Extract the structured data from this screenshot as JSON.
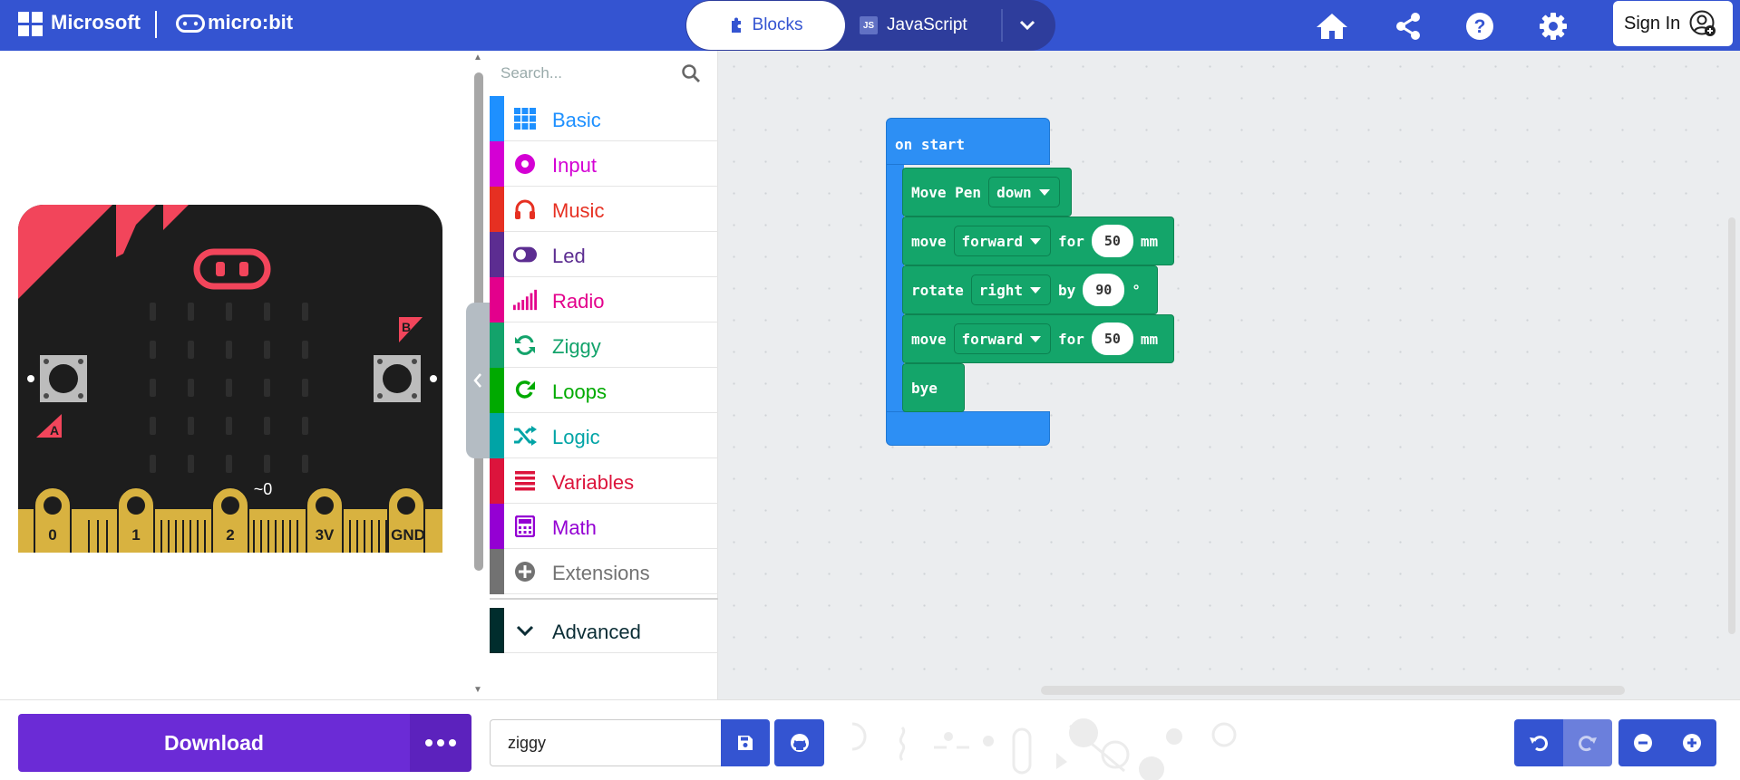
{
  "header": {
    "microsoft_label": "Microsoft",
    "product_label": "micro:bit",
    "tab_blocks": "Blocks",
    "tab_javascript": "JavaScript",
    "js_badge": "JS",
    "sign_in": "Sign In",
    "icons": [
      "home-icon",
      "share-icon",
      "help-icon",
      "settings-icon",
      "user-add-icon"
    ]
  },
  "simulator": {
    "pins": [
      "0",
      "1",
      "2",
      "3V",
      "GND"
    ],
    "touch_label": "~0",
    "button_a": "A",
    "button_b": "B"
  },
  "toolbox": {
    "search_placeholder": "Search...",
    "categories": [
      {
        "label": "Basic",
        "color": "#1e90ff"
      },
      {
        "label": "Input",
        "color": "#d400d4"
      },
      {
        "label": "Music",
        "color": "#e63022"
      },
      {
        "label": "Led",
        "color": "#5c2d91"
      },
      {
        "label": "Radio",
        "color": "#e3008c"
      },
      {
        "label": "Ziggy",
        "color": "#13a36b"
      },
      {
        "label": "Loops",
        "color": "#00aa00"
      },
      {
        "label": "Logic",
        "color": "#00a4a6"
      },
      {
        "label": "Variables",
        "color": "#dc143c"
      },
      {
        "label": "Math",
        "color": "#9400d3"
      },
      {
        "label": "Extensions",
        "color": "#727272"
      }
    ],
    "advanced_label": "Advanced",
    "advanced_color": "#002d2d"
  },
  "workspace": {
    "hat_label": "on start",
    "blocks": [
      {
        "parts": [
          "Move Pen"
        ],
        "dropdown": "down"
      },
      {
        "parts": [
          "move",
          "for",
          "mm"
        ],
        "dropdown": "forward",
        "value": "50"
      },
      {
        "parts": [
          "rotate",
          "by",
          "°"
        ],
        "dropdown": "right",
        "value": "90"
      },
      {
        "parts": [
          "move",
          "for",
          "mm"
        ],
        "dropdown": "forward",
        "value": "50"
      },
      {
        "parts": [
          "bye"
        ]
      }
    ],
    "hat_color": "#2d8ff4",
    "block_color": "#14a56a"
  },
  "footer": {
    "download_label": "Download",
    "project_name": "ziggy"
  }
}
